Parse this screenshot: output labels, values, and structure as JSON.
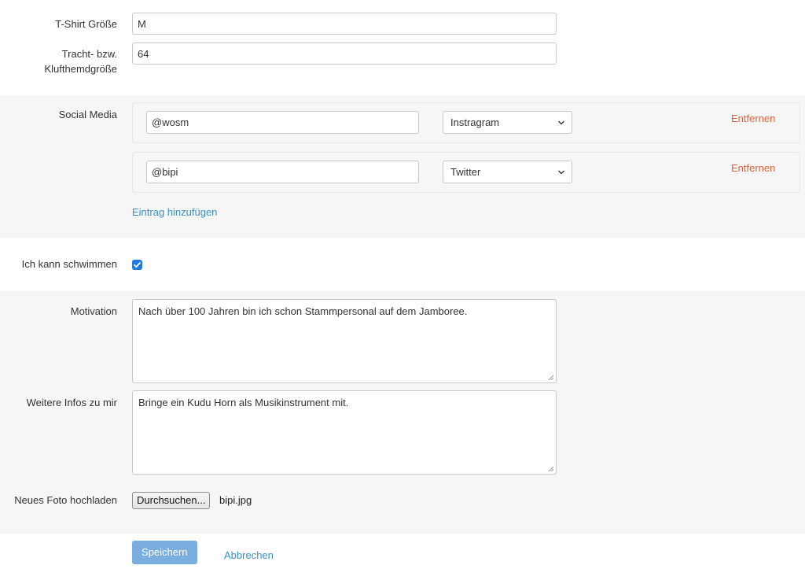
{
  "fields": {
    "tshirt": {
      "label": "T-Shirt Größe",
      "value": "M"
    },
    "tracht": {
      "label_line1": "Tracht- bzw.",
      "label_line2": "Klufthemdgröße",
      "value": "64"
    }
  },
  "social_media": {
    "label": "Social Media",
    "entries": [
      {
        "handle": "@wosm",
        "platform": "Instragram",
        "remove_label": "Entfernen"
      },
      {
        "handle": "@bipi",
        "platform": "Twitter",
        "remove_label": "Entfernen"
      }
    ],
    "add_label": "Eintrag hinzufügen"
  },
  "swim": {
    "label": "Ich kann schwimmen",
    "checked": true
  },
  "motivation": {
    "label": "Motivation",
    "value": "Nach über 100 Jahren bin ich schon Stammpersonal auf dem Jamboree."
  },
  "more_info": {
    "label": "Weitere Infos zu mir",
    "value": "Bringe ein Kudu Horn als Musikinstrument mit."
  },
  "photo": {
    "label": "Neues Foto hochladen",
    "browse_label": "Durchsuchen...",
    "file_name": "bipi.jpg"
  },
  "actions": {
    "save_label": "Speichern",
    "cancel_label": "Abbrechen"
  },
  "colors": {
    "link": "#3b8fc9",
    "remove": "#e3623d",
    "primary": "#7aaede",
    "checkbox": "#1f7ae0",
    "band": "#f5f6f5"
  }
}
